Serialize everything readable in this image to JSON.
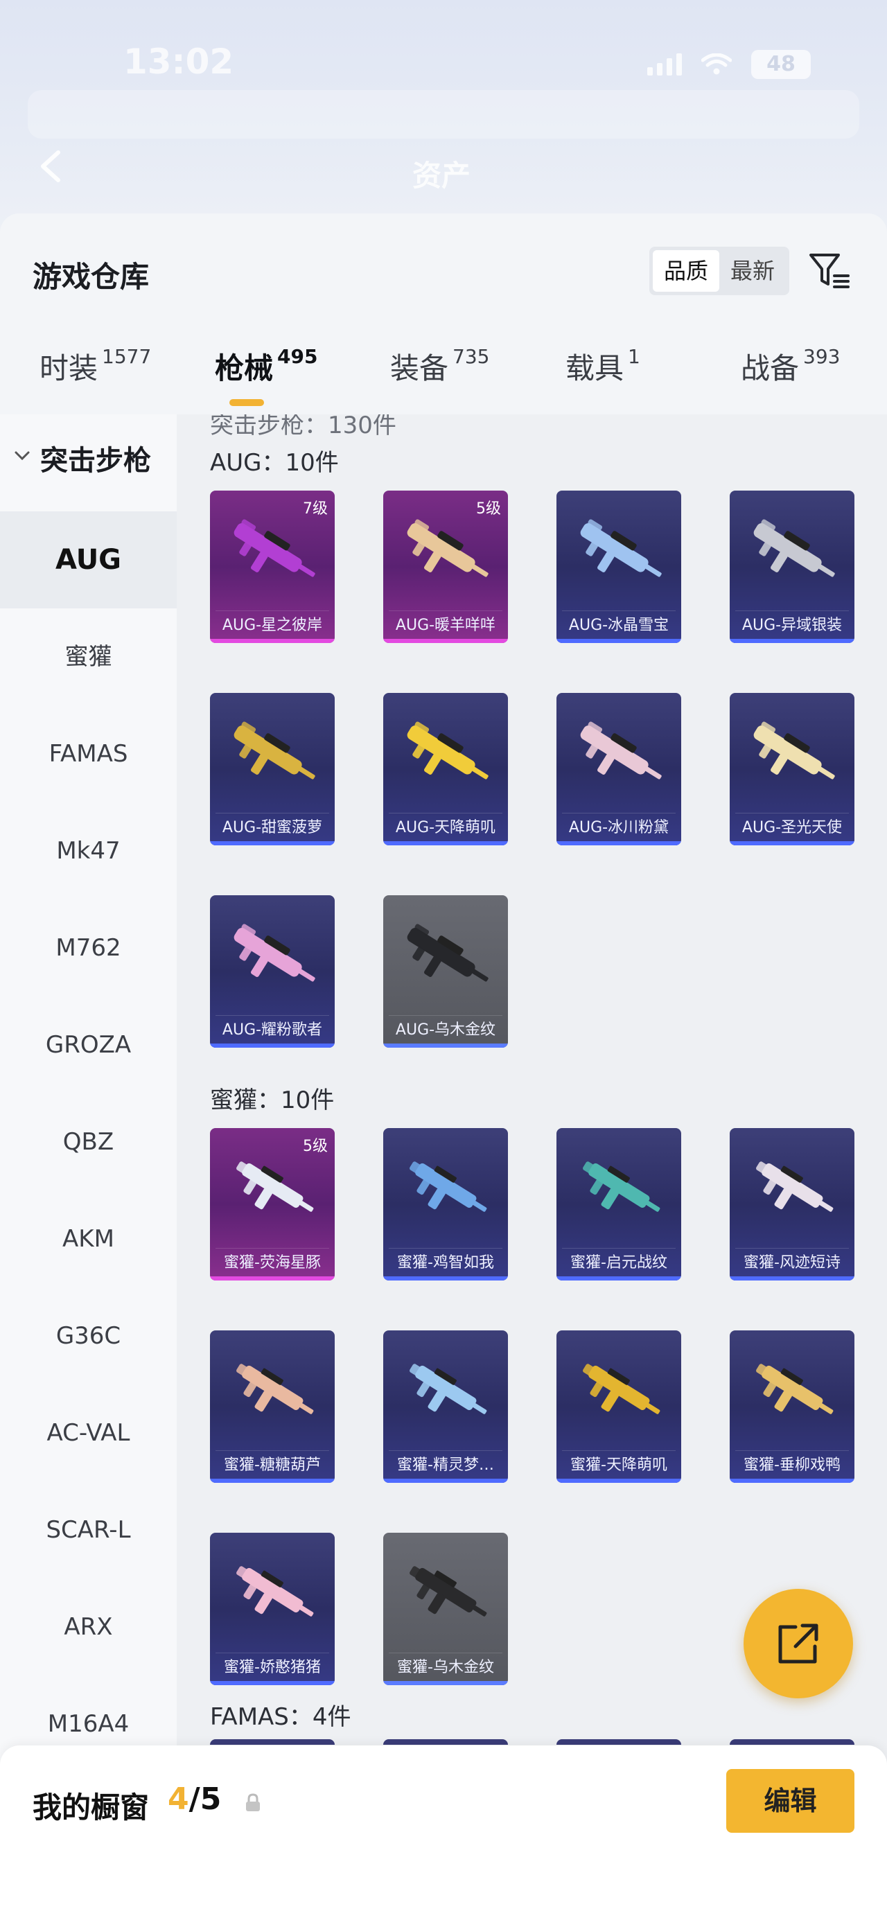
{
  "status_bar": {
    "time": "13:02",
    "battery": "48"
  },
  "page_header": {
    "title": "资产",
    "subtitle": ""
  },
  "sheet": {
    "title": "游戏仓库",
    "sort": {
      "options": [
        "品质",
        "最新"
      ],
      "active": "品质"
    }
  },
  "tabs": [
    {
      "label": "时装",
      "count": "1577"
    },
    {
      "label": "枪械",
      "count": "495",
      "active": true
    },
    {
      "label": "装备",
      "count": "735"
    },
    {
      "label": "载具",
      "count": "1"
    },
    {
      "label": "战备",
      "count": "393"
    }
  ],
  "sidebar": {
    "category": "突击步枪",
    "items": [
      "AUG",
      "蜜獾",
      "FAMAS",
      "Mk47",
      "M762",
      "GROZA",
      "QBZ",
      "AKM",
      "G36C",
      "AC-VAL",
      "SCAR-L",
      "ARX",
      "M16A4"
    ],
    "active": "AUG"
  },
  "content": {
    "category_header": "突击步枪：130件",
    "groups": [
      {
        "label": "AUG：10件",
        "items": [
          {
            "name": "AUG-星之彼岸",
            "level": "7级",
            "rarity": "pink",
            "color": "#b23fd3"
          },
          {
            "name": "AUG-暖羊咩咩",
            "level": "5级",
            "rarity": "pink",
            "color": "#e8c79a"
          },
          {
            "name": "AUG-冰晶雪宝",
            "level": "",
            "rarity": "blue",
            "color": "#9fc3f0"
          },
          {
            "name": "AUG-异域银装",
            "level": "",
            "rarity": "blue",
            "color": "#c7c9d2"
          },
          {
            "name": "AUG-甜蜜菠萝",
            "level": "",
            "rarity": "blue",
            "color": "#d9b340"
          },
          {
            "name": "AUG-天降萌叽",
            "level": "",
            "rarity": "blue",
            "color": "#f1cc3a"
          },
          {
            "name": "AUG-冰川粉黛",
            "level": "",
            "rarity": "blue",
            "color": "#e9c8d6"
          },
          {
            "name": "AUG-圣光天使",
            "level": "",
            "rarity": "blue",
            "color": "#efe0b0"
          },
          {
            "name": "AUG-耀粉歌者",
            "level": "",
            "rarity": "blue",
            "color": "#e6a4d8"
          },
          {
            "name": "AUG-乌木金纹",
            "level": "",
            "rarity": "gray",
            "color": "#26272b"
          }
        ]
      },
      {
        "label": "蜜獾：10件",
        "items": [
          {
            "name": "蜜獾-荧海星豚",
            "level": "5级",
            "rarity": "pink",
            "color": "#e6ebf4"
          },
          {
            "name": "蜜獾-鸡智如我",
            "level": "",
            "rarity": "blue",
            "color": "#6fa8e8"
          },
          {
            "name": "蜜獾-启元战纹",
            "level": "",
            "rarity": "blue",
            "color": "#4fb8b0"
          },
          {
            "name": "蜜獾-风迹短诗",
            "level": "",
            "rarity": "blue",
            "color": "#e8e0ea"
          },
          {
            "name": "蜜獾-糖糖葫芦",
            "level": "",
            "rarity": "blue",
            "color": "#e9b9a0"
          },
          {
            "name": "蜜獾-精灵梦…",
            "level": "",
            "rarity": "blue",
            "color": "#9cc9f0"
          },
          {
            "name": "蜜獾-天降萌叽",
            "level": "",
            "rarity": "blue",
            "color": "#e3b530"
          },
          {
            "name": "蜜獾-垂柳戏鸭",
            "level": "",
            "rarity": "blue",
            "color": "#e7c16a"
          },
          {
            "name": "蜜獾-娇憨猪猪",
            "level": "",
            "rarity": "blue",
            "color": "#f1bcd2"
          },
          {
            "name": "蜜獾-乌木金纹",
            "level": "",
            "rarity": "gray",
            "color": "#2a2a2c"
          }
        ]
      },
      {
        "label": "FAMAS：4件",
        "items": []
      }
    ]
  },
  "showcase": {
    "label": "我的橱窗",
    "current": "4",
    "total": "/5",
    "edit_label": "编辑"
  },
  "colors": {
    "accent": "#f3b630",
    "rare_blue": "#4f6bff",
    "rare_pink": "#e34ae0"
  }
}
